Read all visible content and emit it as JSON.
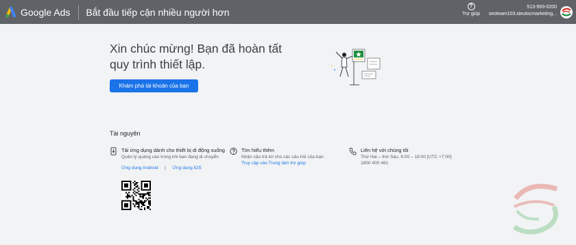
{
  "header": {
    "logo_text": "Google Ads",
    "title": "Bắt đầu tiếp cận nhiều người hơn",
    "help_label": "Trợ giúp",
    "account_id": "513-993-0200",
    "account_name": "seoteam103.sieutocmarketing..."
  },
  "main": {
    "headline": "Xin chúc mừng! Bạn đã hoàn tất quy trình thiết lập.",
    "cta_label": "Khám phá tài khoản của bạn"
  },
  "resources": {
    "title": "Tài nguyên",
    "mobile": {
      "heading": "Tải ứng dụng dành cho thiết bị di động xuống",
      "subtext": "Quản lý quảng cáo trong khi bạn đang di chuyển",
      "android_link": "Ứng dụng Android",
      "separator": "|",
      "ios_link": "Ứng dụng iOS"
    },
    "learn": {
      "heading": "Tìm hiểu thêm",
      "subtext": "Nhận câu trả lời cho các câu hỏi của bạn",
      "link": "Truy cập vào Trung tâm trợ giúp"
    },
    "contact": {
      "heading": "Liên hệ với chúng tôi",
      "hours": "Thứ Hai – thứ Sáu, 9:00 – 18:00 [UTC +7:00]",
      "phone": "1800 400 461"
    }
  },
  "colors": {
    "header_bg": "#5f6368",
    "page_bg": "#f1f3f4",
    "primary": "#1a73e8",
    "illustration_accent": "#1e8e3e"
  },
  "icons": {
    "logo": "google-ads-logo-icon",
    "help": "help-circle-icon",
    "mobile": "phone-download-icon",
    "learn": "question-circle-icon",
    "contact": "phone-call-icon"
  }
}
